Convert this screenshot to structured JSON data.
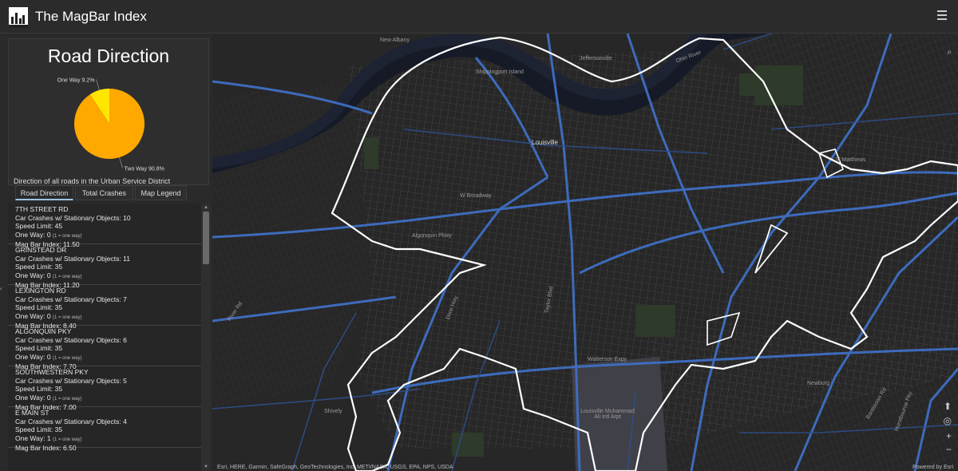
{
  "app": {
    "title": "The MagBar Index"
  },
  "chart_data": {
    "type": "pie",
    "title": "Road Direction",
    "caption": "Direction of all roads in the Urban Service District",
    "slices": [
      {
        "label": "Two Way 90.8%",
        "value": 90.8,
        "color": "#ffa800"
      },
      {
        "label": "One Way 9.2%",
        "value": 9.2,
        "color": "#ffe600"
      }
    ]
  },
  "tabs": [
    {
      "label": "Road Direction"
    },
    {
      "label": "Total Crashes"
    },
    {
      "label": "Map Legend"
    }
  ],
  "roads": [
    {
      "name": "7TH STREET RD",
      "crashes": "Car Crashes w/ Stationary Objects: 10",
      "speed": "Speed Limit: 45",
      "oneway": "One Way: 0",
      "oneway_note": "(1 = one way)",
      "index": "Mag Bar Index: 11.50"
    },
    {
      "name": "GRINSTEAD DR",
      "crashes": "Car Crashes w/ Stationary Objects: 11",
      "speed": "Speed Limit: 35",
      "oneway": "One Way: 0",
      "oneway_note": "(1 = one way)",
      "index": "Mag Bar Index: 11.20"
    },
    {
      "name": "LEXINGTON RD",
      "crashes": "Car Crashes w/ Stationary Objects: 7",
      "speed": "Speed Limit: 35",
      "oneway": "One Way: 0",
      "oneway_note": "(1 = one way)",
      "index": "Mag Bar Index: 8.40"
    },
    {
      "name": "ALGONQUIN PKY",
      "crashes": "Car Crashes w/ Stationary Objects: 6",
      "speed": "Speed Limit: 35",
      "oneway": "One Way: 0",
      "oneway_note": "(1 = one way)",
      "index": "Mag Bar Index: 7.70"
    },
    {
      "name": "SOUTHWESTERN PKY",
      "crashes": "Car Crashes w/ Stationary Objects: 5",
      "speed": "Speed Limit: 35",
      "oneway": "One Way: 0",
      "oneway_note": "(1 = one way)",
      "index": "Mag Bar Index: 7.00"
    },
    {
      "name": "E MAIN ST",
      "crashes": "Car Crashes w/ Stationary Objects: 4",
      "speed": "Speed Limit: 35",
      "oneway": "One Way: 1",
      "oneway_note": "(1 = one way)",
      "index": "Mag Bar Index: 6.50"
    }
  ],
  "map": {
    "labels": {
      "new_albany": "New Albany",
      "jeffersonville": "Jeffersonville",
      "shippingport": "Shippingport Island",
      "ohio_river": "Ohio River",
      "louisville": "Louisville",
      "st_matthews": "St Matthews",
      "broadway": "W Broadway",
      "taylor_blvd": "Taylor Blvd",
      "watterson": "Watterson Expy",
      "airport": "Louisville Muhammad Ali Intl Arpt",
      "bardstown": "Bardstown Rd",
      "shively": "Shively",
      "newburg": "Newburg",
      "fern_creek_rd": "Hurstbourne Pky",
      "dixie": "Dixie Hwy",
      "river_rd": "River Rd",
      "algonquin": "Algonquin Pkwy"
    },
    "attribution": "Esri, HERE, Garmin, SafeGraph, GeoTechnologies, Inc, METI/NASA, USGS, EPA, NPS, USDA",
    "powered_by": "Powered by Esri"
  },
  "colors": {
    "background": "#242424",
    "road_blue": "#3f6fc4",
    "boundary": "#ffffff",
    "river": "#161a26"
  }
}
